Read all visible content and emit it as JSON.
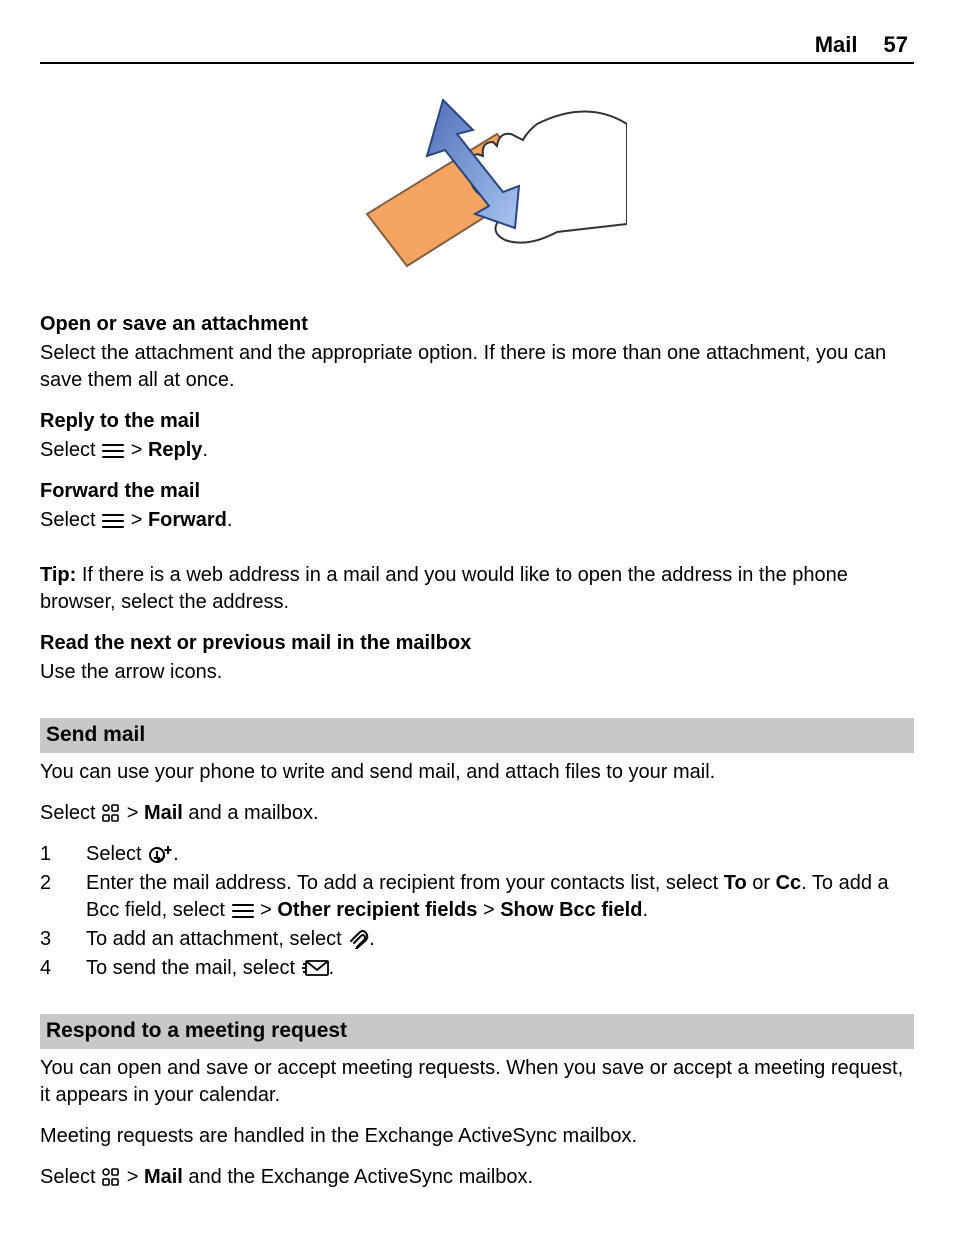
{
  "header": {
    "section": "Mail",
    "page_number": "57"
  },
  "sec_attach": {
    "title": "Open or save an attachment",
    "body": "Select the attachment and the appropriate option. If there is more than one attachment, you can save them all at once."
  },
  "sec_reply": {
    "title": "Reply to the mail",
    "select_word": "Select ",
    "after_icon": " > ",
    "action": "Reply",
    "period": "."
  },
  "sec_forward": {
    "title": "Forward the mail",
    "select_word": "Select ",
    "after_icon": " > ",
    "action": "Forward",
    "period": "."
  },
  "sec_tip": {
    "label": "Tip:",
    "body": " If there is a web address in a mail and you would like to open the address in the phone browser, select the address."
  },
  "sec_read": {
    "title": "Read the next or previous mail in the mailbox",
    "body": "Use the arrow icons."
  },
  "send": {
    "bar": "Send mail",
    "intro": "You can use your phone to write and send mail, and attach files to your mail.",
    "select_word": "Select ",
    "after_icon": " > ",
    "mail_word": "Mail",
    "after_mail": " and a mailbox.",
    "step1_pre": "Select ",
    "step1_post": ".",
    "step2_a": "Enter the mail address. To add a recipient from your contacts list, select ",
    "step2_to": "To",
    "step2_or": " or ",
    "step2_cc": "Cc",
    "step2_b": ". To add a Bcc field, select ",
    "step2_after_icon": " > ",
    "step2_other": "Other recipient fields",
    "step2_mid": "  > ",
    "step2_show": "Show Bcc field",
    "step2_period": ".",
    "step3_pre": "To add an attachment, select ",
    "step3_post": ".",
    "step4_pre": "To send the mail, select ",
    "step4_post": "."
  },
  "respond": {
    "bar": "Respond to a meeting request",
    "p1": "You can open and save or accept meeting requests. When you save or accept a meeting request, it appears in your calendar.",
    "p2": "Meeting requests are handled in the Exchange ActiveSync mailbox.",
    "select_word": "Select ",
    "after_icon": " > ",
    "mail_word": "Mail",
    "after_mail": " and the Exchange ActiveSync mailbox."
  }
}
